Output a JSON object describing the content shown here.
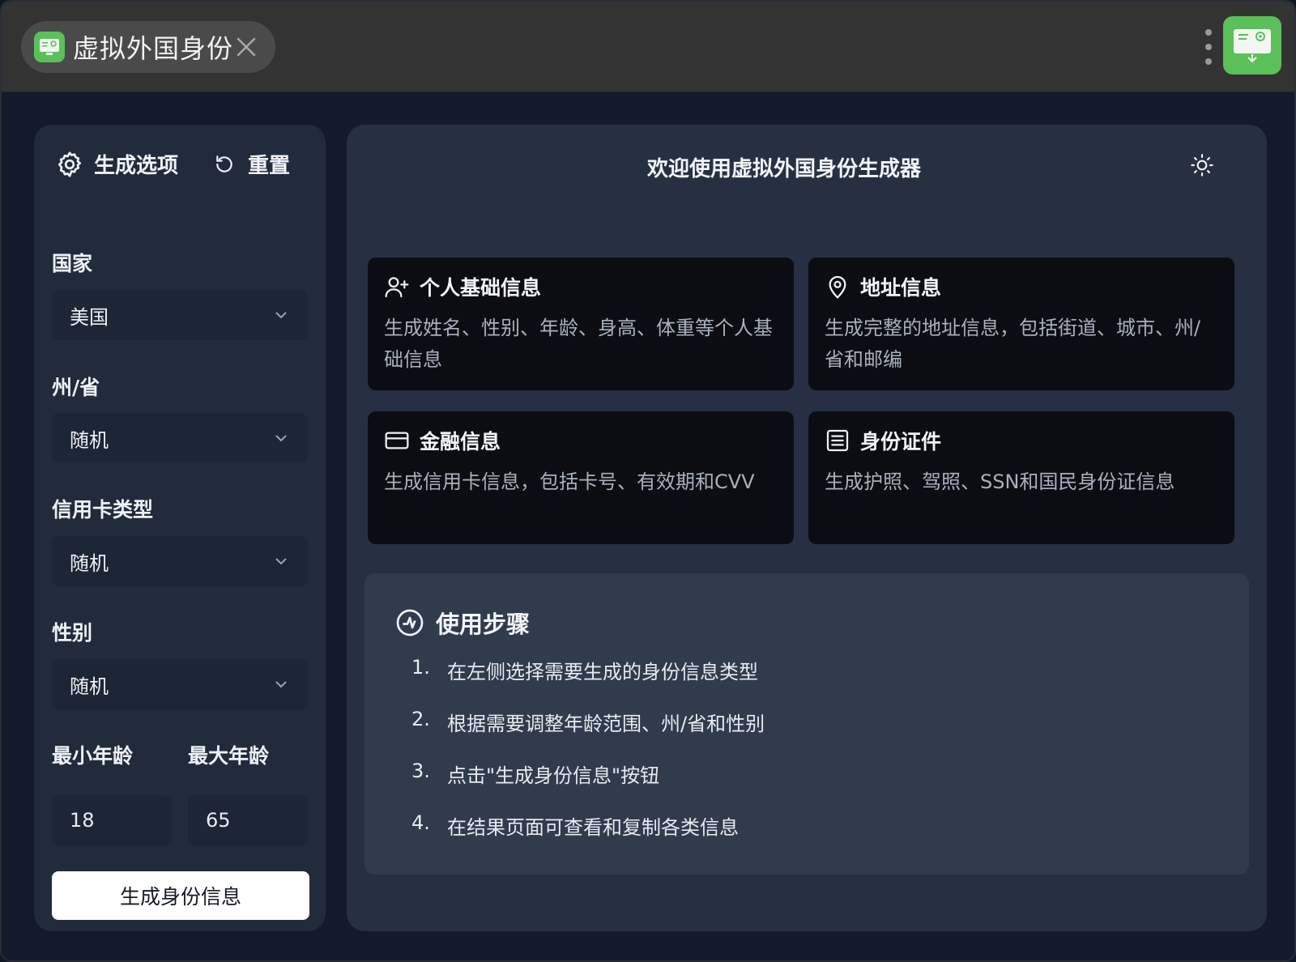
{
  "titlebar": {
    "tab_title": "虚拟外国身份",
    "tab_icon": "app-icon",
    "colors": {
      "accent": "#5cc05a"
    }
  },
  "sidebar": {
    "header_label": "生成选项",
    "reset_label": "重置",
    "country": {
      "label": "国家",
      "value": "美国"
    },
    "state": {
      "label": "州/省",
      "value": "随机"
    },
    "card_type": {
      "label": "信用卡类型",
      "value": "随机"
    },
    "gender": {
      "label": "性别",
      "value": "随机"
    },
    "min_age": {
      "label": "最小年龄",
      "value": "18"
    },
    "max_age": {
      "label": "最大年龄",
      "value": "65"
    },
    "generate_label": "生成身份信息"
  },
  "main": {
    "title": "欢迎使用虚拟外国身份生成器",
    "cards": [
      {
        "icon": "user-plus-icon",
        "title": "个人基础信息",
        "desc": "生成姓名、性别、年龄、身高、体重等个人基础信息"
      },
      {
        "icon": "map-pin-icon",
        "title": "地址信息",
        "desc": "生成完整的地址信息，包括街道、城市、州/省和邮编"
      },
      {
        "icon": "credit-card-icon",
        "title": "金融信息",
        "desc": "生成信用卡信息，包括卡号、有效期和CVV"
      },
      {
        "icon": "document-icon",
        "title": "身份证件",
        "desc": "生成护照、驾照、SSN和国民身份证信息"
      }
    ],
    "steps": {
      "title": "使用步骤",
      "items": [
        {
          "num": "1.",
          "text": "在左侧选择需要生成的身份信息类型"
        },
        {
          "num": "2.",
          "text": "根据需要调整年龄范围、州/省和性别"
        },
        {
          "num": "3.",
          "text": "点击\"生成身份信息\"按钮"
        },
        {
          "num": "4.",
          "text": "在结果页面可查看和复制各类信息"
        }
      ]
    }
  }
}
